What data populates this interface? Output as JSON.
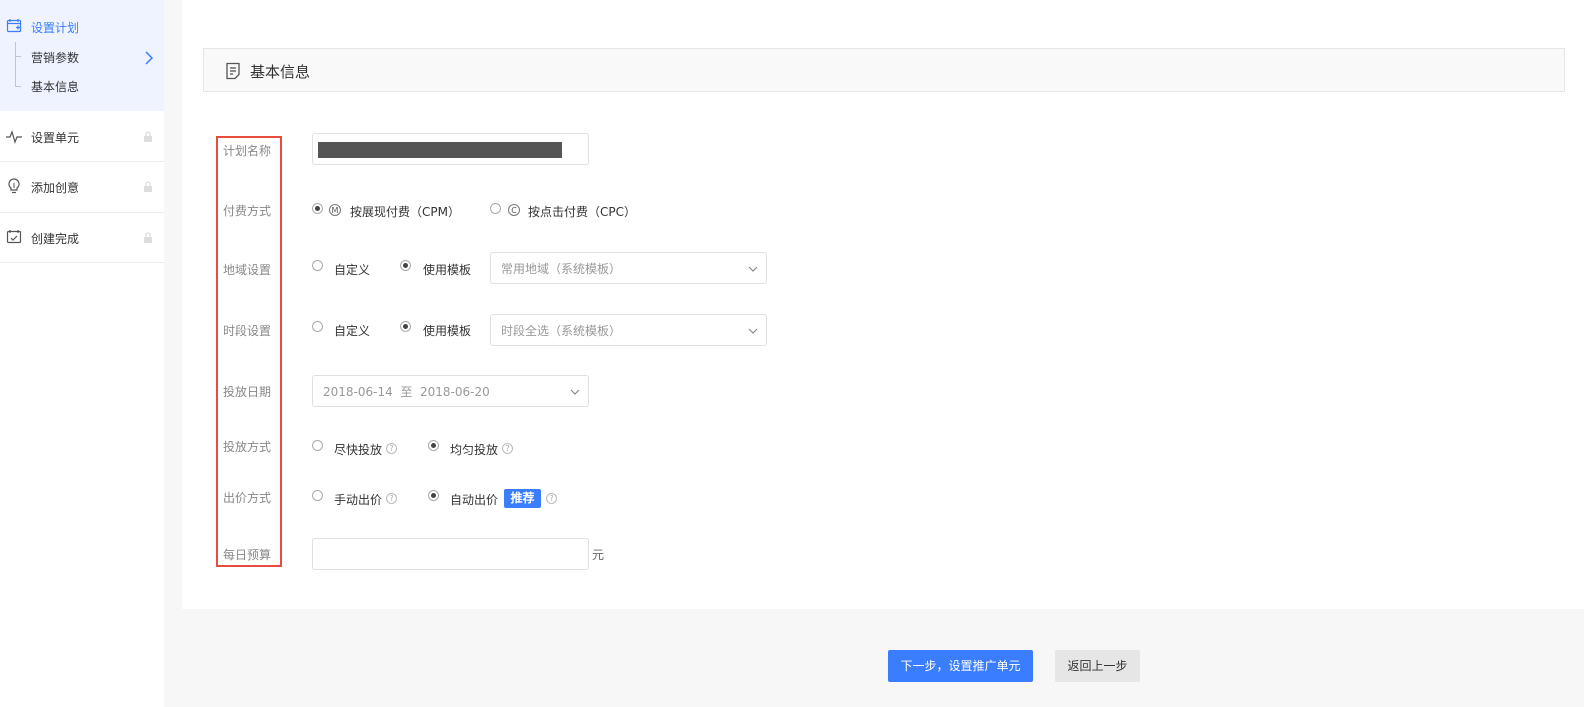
{
  "sidebar": {
    "plan": {
      "label": "设置计划",
      "sub": [
        "营销参数",
        "基本信息"
      ]
    },
    "unit": {
      "label": "设置单元"
    },
    "creative": {
      "label": "添加创意"
    },
    "done": {
      "label": "创建完成"
    }
  },
  "section": {
    "title": "基本信息"
  },
  "form": {
    "plan_name": {
      "label": "计划名称"
    },
    "payment": {
      "label": "付费方式",
      "options": [
        {
          "icon_letter": "M",
          "text": "按展现付费（CPM）",
          "checked": true
        },
        {
          "icon_letter": "C",
          "text": "按点击付费（CPC）",
          "checked": false
        }
      ]
    },
    "region": {
      "label": "地域设置",
      "options": [
        {
          "text": "自定义",
          "checked": false
        },
        {
          "text": "使用模板",
          "checked": true
        }
      ],
      "select": "常用地域（系统模板）"
    },
    "time": {
      "label": "时段设置",
      "options": [
        {
          "text": "自定义",
          "checked": false
        },
        {
          "text": "使用模板",
          "checked": true
        }
      ],
      "select": "时段全选（系统模板）"
    },
    "date": {
      "label": "投放日期",
      "value": "2018-06-14  至  2018-06-20"
    },
    "delivery": {
      "label": "投放方式",
      "options": [
        {
          "text": "尽快投放",
          "checked": false
        },
        {
          "text": "均匀投放",
          "checked": true
        }
      ]
    },
    "bid": {
      "label": "出价方式",
      "options": [
        {
          "text": "手动出价",
          "checked": false
        },
        {
          "text": "自动出价",
          "checked": true
        }
      ],
      "badge": "推荐"
    },
    "budget": {
      "label": "每日预算",
      "unit": "元"
    }
  },
  "buttons": {
    "next": "下一步，设置推广单元",
    "back": "返回上一步"
  },
  "colors": {
    "primary": "#3b7dff",
    "highlight_border": "#e74c3c",
    "sidebar_active_bg": "#eef3ff"
  }
}
